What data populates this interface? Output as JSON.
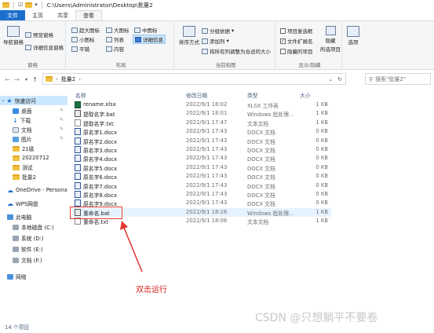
{
  "window": {
    "path": "C:\\Users\\Administrator\\Desktop\\批量2"
  },
  "tabs": [
    "文件",
    "主页",
    "共享",
    "查看"
  ],
  "ribbon": {
    "pane": {
      "nav_pane": "导航窗格",
      "preview": "预览窗格",
      "details": "详细信息窗格",
      "label": "窗格"
    },
    "layout": {
      "xl_icons": "超大图标",
      "large_icons": "大图标",
      "medium_icons": "中图标",
      "small_icons": "小图标",
      "list": "列表",
      "details": "详细信息",
      "tiles": "平铺",
      "content": "内容",
      "label": "布局"
    },
    "view": {
      "sort": "排序方式",
      "group_by": "分组依据",
      "add_column": "添加列",
      "fit_columns": "将所有列调整为合适的大小",
      "label": "当前视图"
    },
    "show": {
      "item_checkbox": "项目复选框",
      "file_ext": "文件扩展名",
      "hidden_items": "隐藏的项目",
      "hide_selected": "隐藏",
      "hide_selected_2": "所选项目",
      "label": "显示/隐藏"
    },
    "options": "选项"
  },
  "address": {
    "crumb": "批量2",
    "search_placeholder": "搜索\"批量2\""
  },
  "nav_pane": {
    "quick_access": "快速访问",
    "desktop": "桌面",
    "downloads": "下载",
    "documents": "文档",
    "pictures": "图片",
    "f21": "21级",
    "f20220712": "20220712",
    "test": "测试",
    "batch2": "批量2",
    "onedrive": "OneDrive - Persona",
    "wps": "WPS网盘",
    "this_pc": "此电脑",
    "disk_c": "本地磁盘 (C:)",
    "disk_d": "系统 (D:)",
    "disk_e": "软件 (E:)",
    "disk_f": "文档 (F:)",
    "network": "网络"
  },
  "columns": {
    "name": "名称",
    "date": "修改日期",
    "type": "类型",
    "size": "大小"
  },
  "files": [
    {
      "name": "rename.xlsx",
      "date": "2022/9/1 18:02",
      "type": "XLSX 工作表",
      "size": "1 KB",
      "kind": "xlsx"
    },
    {
      "name": "提取名字.bat",
      "date": "2022/9/1 18:01",
      "type": "Windows 批处理...",
      "size": "1 KB",
      "kind": "bat"
    },
    {
      "name": "提取名字.txt",
      "date": "2022/9/1 17:47",
      "type": "文本文档",
      "size": "1 KB",
      "kind": "txt"
    },
    {
      "name": "原名字1.docx",
      "date": "2022/9/1 17:43",
      "type": "DOCX 文档",
      "size": "0 KB",
      "kind": "docx"
    },
    {
      "name": "原名字2.docx",
      "date": "2022/9/1 17:43",
      "type": "DOCX 文档",
      "size": "0 KB",
      "kind": "docx"
    },
    {
      "name": "原名字3.docx",
      "date": "2022/9/1 17:43",
      "type": "DOCX 文档",
      "size": "0 KB",
      "kind": "docx"
    },
    {
      "name": "原名字4.docx",
      "date": "2022/9/1 17:43",
      "type": "DOCX 文档",
      "size": "0 KB",
      "kind": "docx"
    },
    {
      "name": "原名字5.docx",
      "date": "2022/9/1 17:43",
      "type": "DOCX 文档",
      "size": "0 KB",
      "kind": "docx"
    },
    {
      "name": "原名字6.docx",
      "date": "2022/9/1 17:43",
      "type": "DOCX 文档",
      "size": "0 KB",
      "kind": "docx"
    },
    {
      "name": "原名字7.docx",
      "date": "2022/9/1 17:43",
      "type": "DOCX 文档",
      "size": "0 KB",
      "kind": "docx"
    },
    {
      "name": "原名字8.docx",
      "date": "2022/9/1 17:43",
      "type": "DOCX 文档",
      "size": "0 KB",
      "kind": "docx"
    },
    {
      "name": "原名字9.docx",
      "date": "2022/9/1 17:43",
      "type": "DOCX 文档",
      "size": "0 KB",
      "kind": "docx"
    },
    {
      "name": "重命名.bat",
      "date": "2022/9/1 18:26",
      "type": "Windows 批处理...",
      "size": "1 KB",
      "kind": "bat"
    },
    {
      "name": "重命名.txt",
      "date": "2022/9/1 18:06",
      "type": "文本文档",
      "size": "1 KB",
      "kind": "txt"
    }
  ],
  "annotation": "双击运行",
  "status": "14 个项目",
  "watermark": "CSDN @只想躺平不要卷",
  "colors": {
    "accent": "#1a6ecc",
    "annotation": "#e53935"
  }
}
